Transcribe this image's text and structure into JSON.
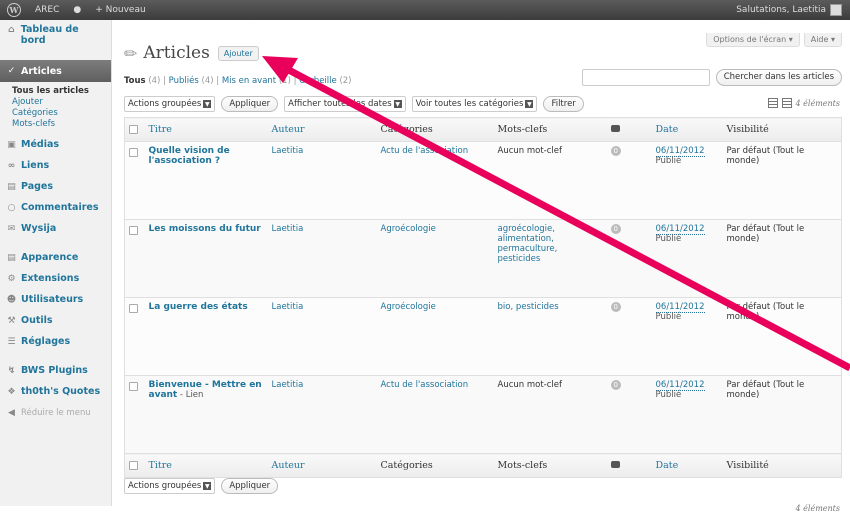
{
  "adminbar": {
    "site_name": "AREC",
    "new_label": "Nouveau",
    "greeting": "Salutations, Laetitia"
  },
  "menu": {
    "dashboard": "Tableau de bord",
    "articles": "Articles",
    "sub": [
      "Tous les articles",
      "Ajouter",
      "Catégories",
      "Mots-clefs"
    ],
    "items": [
      "Médias",
      "Liens",
      "Pages",
      "Commentaires",
      "Wysija"
    ],
    "items2": [
      "Apparence",
      "Extensions",
      "Utilisateurs",
      "Outils",
      "Réglages"
    ],
    "items3": [
      "BWS Plugins",
      "th0th's Quotes"
    ],
    "collapse": "Réduire le menu"
  },
  "screen": {
    "options": "Options de l'écran",
    "help": "Aide"
  },
  "page": {
    "title": "Articles",
    "add": "Ajouter"
  },
  "views": {
    "all": "Tous",
    "all_count": "(4)",
    "published": "Publiés",
    "published_count": "(4)",
    "featured": "Mis en avant",
    "featured_count": "(1)",
    "trash": "Corbeille",
    "trash_count": "(2)"
  },
  "search": {
    "button": "Chercher dans les articles"
  },
  "actions": {
    "bulk": "Actions groupées",
    "apply": "Appliquer",
    "dates": "Afficher toutes les dates",
    "cats": "Voir toutes les catégories",
    "filter": "Filtrer"
  },
  "count": "4 éléments",
  "columns": {
    "title": "Titre",
    "author": "Auteur",
    "categories": "Catégories",
    "tags": "Mots-clefs",
    "date": "Date",
    "visibility": "Visibilité"
  },
  "rows": [
    {
      "title": "Quelle vision de l'association ?",
      "suffix": "",
      "author": "Laetitia",
      "category": "Actu de l'association",
      "tags": "Aucun mot-clef",
      "comments": "0",
      "date": "06/11/2012",
      "status": "Publié",
      "visibility": "Par défaut (Tout le monde)"
    },
    {
      "title": "Les moissons du futur",
      "suffix": "",
      "author": "Laetitia",
      "category": "Agroécologie",
      "tags": "agroécologie, alimentation, permaculture, pesticides",
      "comments": "0",
      "date": "06/11/2012",
      "status": "Publié",
      "visibility": "Par défaut (Tout le monde)"
    },
    {
      "title": "La guerre des états",
      "suffix": "",
      "author": "Laetitia",
      "category": "Agroécologie",
      "tags": "bio, pesticides",
      "comments": "0",
      "date": "06/11/2012",
      "status": "Publié",
      "visibility": "Par défaut (Tout le monde)"
    },
    {
      "title": "Bienvenue - Mettre en avant",
      "suffix": " - Lien",
      "author": "Laetitia",
      "category": "Actu de l'association",
      "tags": "Aucun mot-clef",
      "comments": "0",
      "date": "06/11/2012",
      "status": "Publié",
      "visibility": "Par défaut (Tout le monde)"
    }
  ],
  "colors": {
    "accent": "#21759b",
    "arrow": "#e8005a",
    "menu_active": "#6d6d6d"
  }
}
